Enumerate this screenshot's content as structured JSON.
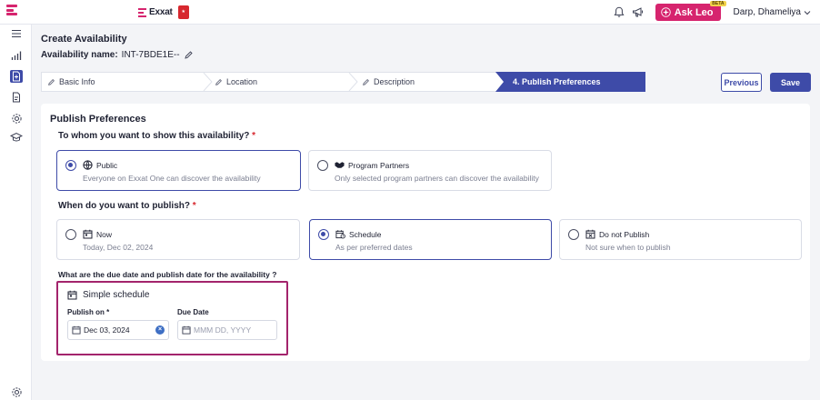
{
  "topbar": {
    "brand": "Exxat",
    "ask_label": "Ask Leo",
    "beta": "BETA",
    "user_name": "Darp, Dhameliya",
    "icons": [
      "menu-icon",
      "bell-icon",
      "megaphone-icon",
      "sparkle-icon",
      "chevron-down-icon"
    ]
  },
  "sidebar": {
    "icons": [
      "hamburger-icon",
      "analytics-icon",
      "add-doc-icon",
      "document-icon",
      "settings-gear-icon",
      "graduation-cap-icon",
      "settings-icon"
    ]
  },
  "header": {
    "title": "Create Availability",
    "name_label": "Availability name:",
    "name_value": "INT-7BDE1E--"
  },
  "stepper": {
    "steps": [
      "Basic Info",
      "Location",
      "Description",
      "4.  Publish Preferences"
    ],
    "active": 3,
    "accent": "#3e4ba8"
  },
  "actions": {
    "previous": "Previous",
    "save": "Save"
  },
  "card": {
    "title": "Publish Preferences",
    "visibility": {
      "question": "To whom you want to show this availability?",
      "required": "*",
      "options": [
        {
          "label": "Public",
          "desc": "Everyone on Exxat One can discover the availability",
          "selected": true
        },
        {
          "label": "Program Partners",
          "desc": "Only selected program partners can discover the availability",
          "selected": false
        }
      ]
    },
    "publish": {
      "question": "When do you want to publish?",
      "required": "*",
      "options": [
        {
          "label": "Now",
          "desc": "Today, Dec 02, 2024",
          "selected": false
        },
        {
          "label": "Schedule",
          "desc": "As per preferred dates",
          "selected": true
        },
        {
          "label": "Do not Publish",
          "desc": "Not sure when to publish",
          "selected": false
        }
      ]
    },
    "dates": {
      "question": "What are the due date and publish date for the availability ?",
      "box_title": "Simple schedule",
      "publish_label": "Publish on *",
      "publish_value": "Dec 03, 2024",
      "due_label": "Due Date",
      "due_placeholder": "MMM DD, YYYY",
      "highlight_color": "#a3246c"
    }
  }
}
